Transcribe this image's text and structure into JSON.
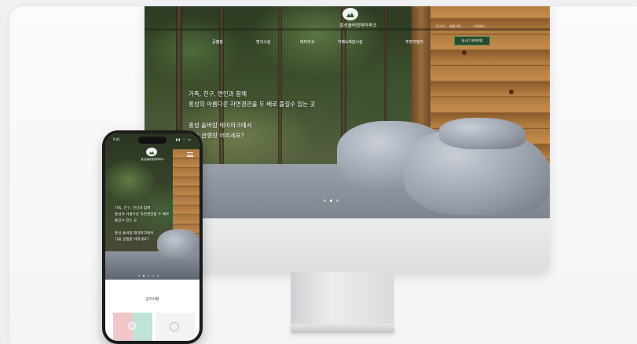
{
  "brand": {
    "name_desktop": "홍성솔바람테마파크",
    "name_mobile": "홍성솔바람테마파크"
  },
  "desktop": {
    "menu": [
      "글램핑",
      "편의시설",
      "테마학교",
      "카페&체험시설",
      "주변여행지"
    ],
    "utility_links": [
      "로그인",
      "회원가입",
      "고객센터"
    ],
    "realtime_button": "실시간 예약현황",
    "hero_lines": [
      "가족, 친구, 연인과 함께",
      "홍성의 아름다운 자연경관을 두 배로 즐길수 있는 곳",
      "홍성 솔바람 테마파크에서",
      "가을 글램핑 어떠세요?"
    ],
    "slide_count": 3,
    "slide_active": 1
  },
  "mobile": {
    "status_time": "9:41",
    "status_icons": "▮▮ ◠ ▭",
    "hero_lines": [
      "가족, 친구, 연인과 함께",
      "홍성의 아름다운 자연경관을 두 배로",
      "즐길수 있는 곳",
      "홍성 솔바람 테마파크에서",
      "가을 글램핑 어떠세요?"
    ],
    "notice_title": "공지사항",
    "slide_count": 5,
    "slide_active": 1
  },
  "colors": {
    "accent_green": "#284b2e",
    "background": "#f3f4f5",
    "wood": "#b07a40"
  },
  "icons": [
    "logo-icon",
    "hamburger-menu-icon",
    "signal-icon",
    "wifi-icon",
    "battery-icon",
    "chevron-icon"
  ]
}
